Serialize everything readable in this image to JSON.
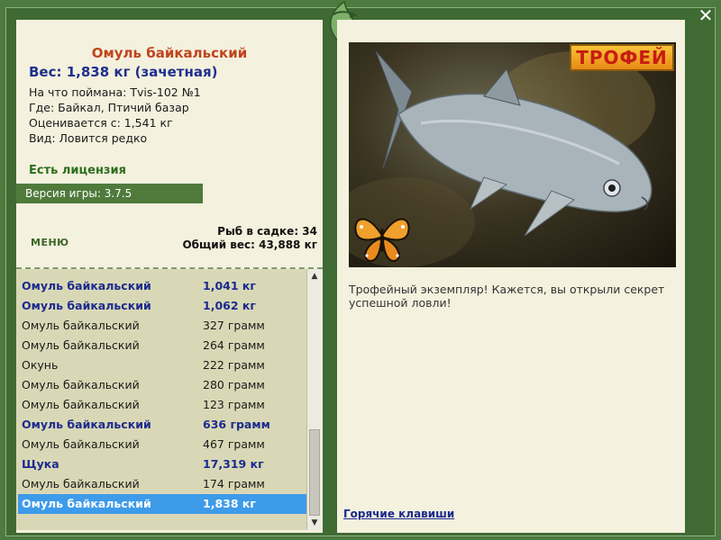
{
  "fish": {
    "title": "Омуль байкальский",
    "weight": "Вес: 1,838 кг (зачетная)",
    "caught_with": "На что поймана: Tvis-102 №1",
    "location": "Где: Байкал, Птичий базар",
    "valued_from": "Оценивается с: 1,541 кг",
    "kind": "Вид: Ловится редко"
  },
  "license": "Есть лицензия",
  "version": "Версия игры: 3.7.5",
  "menu_label": "МЕНЮ",
  "stats": {
    "count": "Рыб в садке: 34",
    "total": "Общий вес: 43,888 кг"
  },
  "catch_list": [
    {
      "name": "Омуль байкальский",
      "weight": "1,041 кг",
      "trophy": true
    },
    {
      "name": "Омуль байкальский",
      "weight": "1,062 кг",
      "trophy": true
    },
    {
      "name": "Омуль байкальский",
      "weight": "327 грамм",
      "trophy": false
    },
    {
      "name": "Омуль байкальский",
      "weight": "264 грамм",
      "trophy": false
    },
    {
      "name": "Окунь",
      "weight": "222 грамм",
      "trophy": false
    },
    {
      "name": "Омуль байкальский",
      "weight": "280 грамм",
      "trophy": false
    },
    {
      "name": "Омуль байкальский",
      "weight": "123 грамм",
      "trophy": false
    },
    {
      "name": "Омуль байкальский",
      "weight": "636 грамм",
      "trophy": true
    },
    {
      "name": "Омуль байкальский",
      "weight": "467 грамм",
      "trophy": false
    },
    {
      "name": "Щука",
      "weight": "17,319 кг",
      "trophy": true
    },
    {
      "name": "Омуль байкальский",
      "weight": "174 грамм",
      "trophy": false
    },
    {
      "name": "Омуль байкальский",
      "weight": "1,838 кг",
      "trophy": true,
      "selected": true
    }
  ],
  "badge": "ТРОФЕЙ",
  "description": "Трофейный экземпляр! Кажется, вы открыли секрет успешной ловли!",
  "hotkeys": "Горячие клавиши",
  "icons": {
    "close": "close-icon",
    "logo": "fish-logo-icon",
    "butterfly": "butterfly-icon"
  },
  "colors": {
    "frame": "#4d7a3f",
    "panel": "#f4f1de",
    "trophy_text": "#1d2b8e",
    "selected": "#3d9be9",
    "title": "#c0441d"
  }
}
